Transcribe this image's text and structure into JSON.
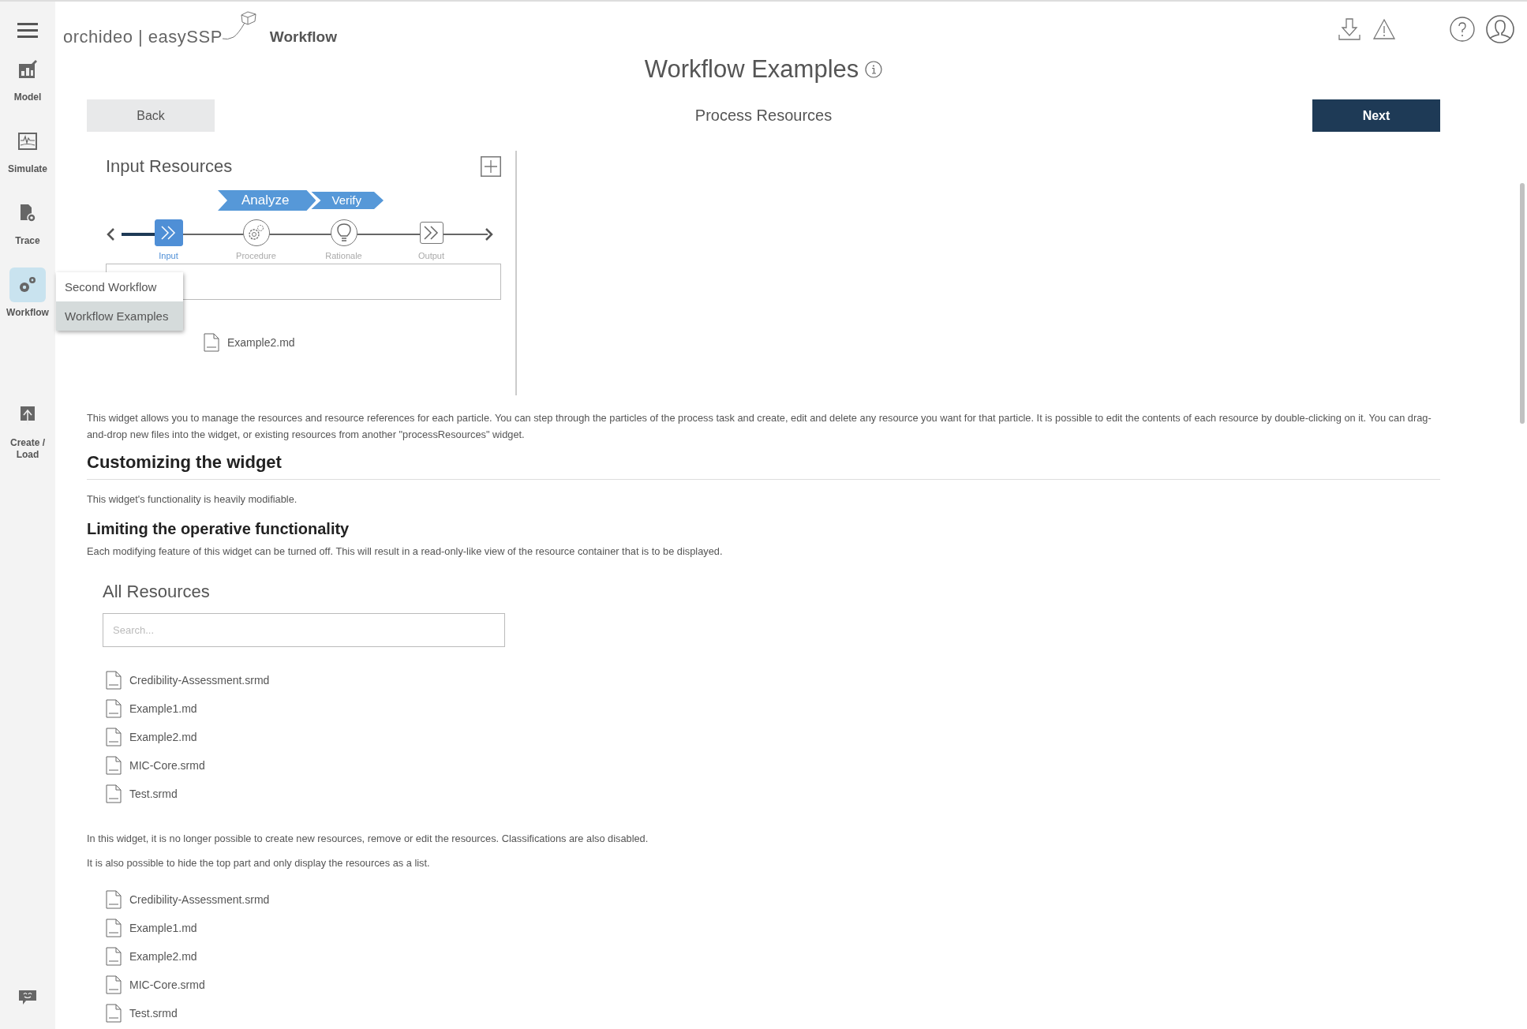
{
  "sidebar": {
    "items": [
      {
        "kind": "model",
        "label": "Model",
        "selected": false
      },
      {
        "kind": "simulate",
        "label": "Simulate",
        "selected": false
      },
      {
        "kind": "trace",
        "label": "Trace",
        "selected": false
      },
      {
        "kind": "workflow",
        "label": "Workflow",
        "selected": true
      },
      {
        "kind": "create",
        "label": "Create / Load",
        "selected": false
      }
    ]
  },
  "header": {
    "brand": "orchideo | easySSP",
    "section": "Workflow"
  },
  "page": {
    "title": "Workflow Examples",
    "step_title": "Process Resources",
    "back": "Back",
    "next": "Next"
  },
  "workflow_menu": {
    "items": [
      {
        "label": "Second Workflow",
        "selected": false
      },
      {
        "label": "Workflow Examples",
        "selected": true
      }
    ]
  },
  "input_widget": {
    "title": "Input Resources",
    "phases": [
      "Analyze",
      "Verify"
    ],
    "particles": [
      {
        "kind": "input",
        "label": "Input",
        "selected": true
      },
      {
        "kind": "procedure",
        "label": "Procedure",
        "selected": false
      },
      {
        "kind": "rationale",
        "label": "Rationale",
        "selected": false
      },
      {
        "kind": "output",
        "label": "Output",
        "selected": false
      }
    ],
    "files": [
      {
        "name": "Example2.md"
      }
    ]
  },
  "intro": "This widget allows you to manage the resources and resource references for each particle. You can step through the particles of the process task and create, edit and delete any resource you want for that particle. It is possible to edit the contents of each resource by double-clicking on it. You can drag-and-drop new files into the widget, or existing resources from another \"processResources\" widget.",
  "section": {
    "heading": "Customizing the widget",
    "text": "This widget's functionality is heavily modifiable."
  },
  "subsection": {
    "heading": "Limiting the operative functionality",
    "text": "Each modifying feature of this widget can be turned off. This will result in a read-only-like view of the resource container that is to be displayed."
  },
  "all_resources": {
    "title": "All Resources",
    "search": {
      "placeholder": "Search..."
    },
    "files": [
      {
        "name": "Credibility-Assessment.srmd"
      },
      {
        "name": "Example1.md"
      },
      {
        "name": "Example2.md"
      },
      {
        "name": "MIC-Core.srmd"
      },
      {
        "name": "Test.srmd"
      }
    ]
  },
  "notes": [
    "In this widget, it is no longer possible to create new resources, remove or edit the resources. Classifications are also disabled.",
    "It is also possible to hide the top part and only display the resources as a list."
  ],
  "list_only": {
    "files": [
      {
        "name": "Credibility-Assessment.srmd"
      },
      {
        "name": "Example1.md"
      },
      {
        "name": "Example2.md"
      },
      {
        "name": "MIC-Core.srmd"
      },
      {
        "name": "Test.srmd"
      }
    ]
  }
}
